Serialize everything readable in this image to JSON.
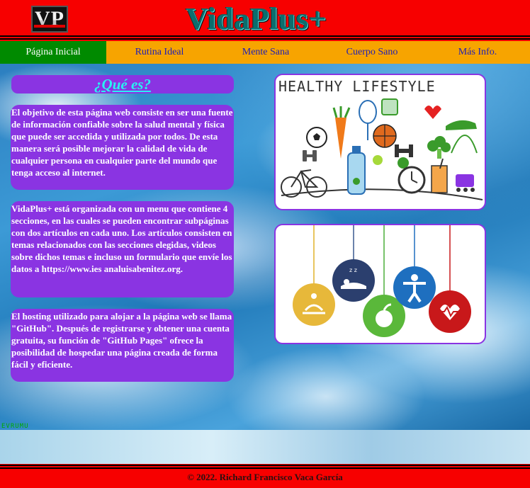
{
  "header": {
    "logo_text": "VP",
    "site_title": "VidaPlus+"
  },
  "nav": {
    "items": [
      {
        "label": "Página Inicial",
        "active": true
      },
      {
        "label": "Rutina Ideal",
        "active": false
      },
      {
        "label": "Mente Sana",
        "active": false
      },
      {
        "label": "Cuerpo Sano",
        "active": false
      },
      {
        "label": "Más Info.",
        "active": false
      }
    ]
  },
  "main": {
    "section_title": "¿Qué es?",
    "paragraphs": [
      "El objetivo de esta página web consiste en ser una fuente de información confiable sobre la salud mental y física que puede ser accedida y utilizada por todos. De esta manera será posible mejorar la calidad de vida de cualquier persona en cualquier parte del mundo que tenga acceso al internet.",
      "VidaPlus+ está organizada con un menu que contiene 4 secciones, en las cuales se pueden encontrar subpáginas con dos artículos en cada uno. Los artículos consisten en temas relacionados con las secciones elegidas, videos sobre dichos temas e incluso un formulario que envíe los datos a https://www.ies analuisabenitez.org.",
      "El hosting utilizado para alojar a la página web se llama \"GitHub\". Después de registrarse y obtener una cuenta gratuita, su función de \"GitHub Pages\" ofrece la posibilidad de hospedar una página creada de forma fácil y eficiente."
    ],
    "image1_caption": "HEALTHY LIFESTYLE",
    "background_watermark": "EVRUMU"
  },
  "footer": {
    "copyright": "© 2022. Richard Francisco Vaca García"
  },
  "colors": {
    "header_red": "#f70000",
    "nav_orange": "#f7a400",
    "nav_active_green": "#008a00",
    "nav_link_blue": "#1e1fb8",
    "box_purple": "#8a34e2",
    "title_cyan": "#29f2f2"
  }
}
